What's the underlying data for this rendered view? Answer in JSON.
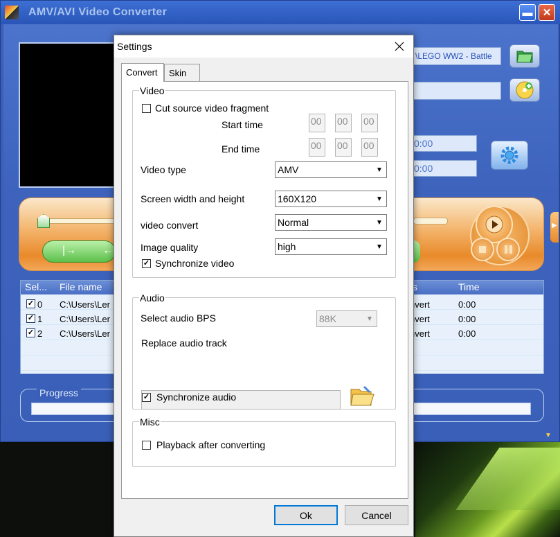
{
  "main_window": {
    "title": "AMV/AVI Video Converter",
    "file_path": "\\LEGO WW2 - Battle",
    "start_time": "0:00",
    "end_time": "0:00",
    "progress_label": "Progress",
    "table": {
      "headers": [
        "Sel...",
        "File name",
        "s",
        "Time"
      ],
      "rows": [
        {
          "index": "0",
          "checked": true,
          "file": "C:\\Users\\Ler",
          "status": "nvert",
          "time": "0:00"
        },
        {
          "index": "1",
          "checked": true,
          "file": "C:\\Users\\Ler",
          "status": "nvert",
          "time": "0:00"
        },
        {
          "index": "2",
          "checked": true,
          "file": "C:\\Users\\Ler",
          "status": "nvert",
          "time": "0:00"
        }
      ]
    }
  },
  "dialog": {
    "title": "Settings",
    "tabs": [
      "Convert",
      "Skin"
    ],
    "active_tab": "Convert",
    "video": {
      "legend": "Video",
      "cut_fragment_label": "Cut source video fragment",
      "cut_fragment_checked": false,
      "start_time_label": "Start time",
      "end_time_label": "End time",
      "start_time_values": [
        "00",
        "00",
        "00"
      ],
      "end_time_values": [
        "00",
        "00",
        "00"
      ],
      "video_type_label": "Video type",
      "video_type_value": "AMV",
      "screen_size_label": "Screen width and height",
      "screen_size_value": "160X120",
      "video_convert_label": "video convert",
      "video_convert_value": "Normal",
      "image_quality_label": "Image quality",
      "image_quality_value": "high",
      "sync_video_label": "Synchronize video",
      "sync_video_checked": true
    },
    "audio": {
      "legend": "Audio",
      "bps_label": "Select audio BPS",
      "bps_value": "88K",
      "replace_track_label": "Replace audio track",
      "replace_track_value": "",
      "sync_audio_label": "Synchronize audio",
      "sync_audio_checked": true
    },
    "misc": {
      "legend": "Misc",
      "playback_label": "Playback after converting",
      "playback_checked": false
    },
    "ok_label": "Ok",
    "cancel_label": "Cancel"
  },
  "colors": {
    "window_blue": "#3a5fb8",
    "accent_orange": "#e88a2a",
    "focus_blue": "#0078d7"
  },
  "icons": [
    "app-icon",
    "minimize-icon",
    "close-icon",
    "folder-open-icon",
    "add-disc-icon",
    "gear-icon",
    "play-icon",
    "stop-icon",
    "pause-icon",
    "checkmark-icon",
    "dropdown-arrow-icon",
    "folder-icon"
  ]
}
